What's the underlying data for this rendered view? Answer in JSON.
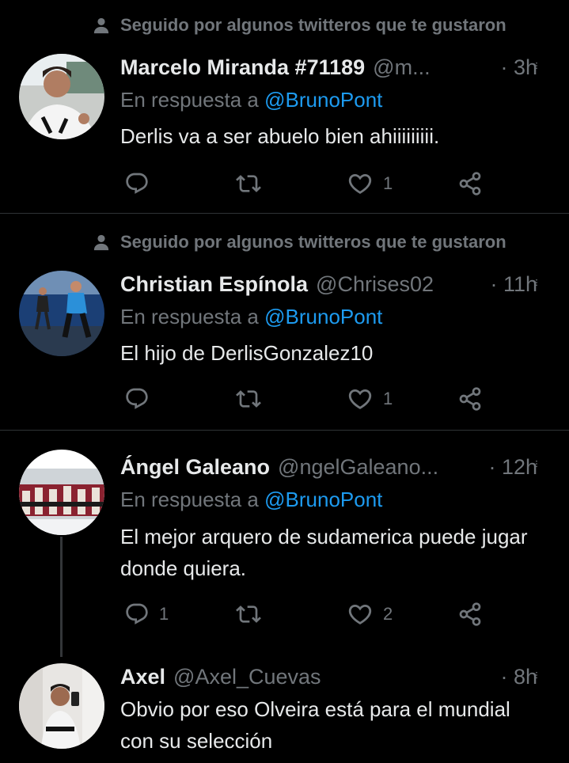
{
  "tweets": [
    {
      "social_context": "Seguido por algunos twitteros que te gustaron",
      "name": "Marcelo Miranda #71189",
      "handle": "@m...",
      "time": "· 3h",
      "reply_to_label": "En respuesta a",
      "reply_to_mention": "@BrunoPont",
      "text": "Derlis va a ser abuelo bien ahiiiiiiiii.",
      "reply_count": "",
      "like_count": "1"
    },
    {
      "social_context": "Seguido por algunos twitteros que te gustaron",
      "name": "Christian Espínola",
      "handle": "@Chrises02",
      "time": "· 11h",
      "reply_to_label": "En respuesta a",
      "reply_to_mention": "@BrunoPont",
      "text": "El hijo de DerlisGonzalez10",
      "reply_count": "",
      "like_count": "1"
    },
    {
      "name": "Ángel Galeano",
      "handle": "@ngelGaleano...",
      "time": "· 12h",
      "reply_to_label": "En respuesta a",
      "reply_to_mention": "@BrunoPont",
      "text": "El mejor arquero de sudamerica puede jugar donde quiera.",
      "reply_count": "1",
      "like_count": "2"
    },
    {
      "name": "Axel",
      "handle": "@Axel_Cuevas",
      "time": "· 8h",
      "text": "Obvio por eso Olveira está para el mundial con su selección"
    }
  ],
  "icons": {
    "social": "person-icon",
    "more": "more-vertical-icon",
    "reply": "reply-icon",
    "retweet": "retweet-icon",
    "like": "like-icon",
    "share": "share-icon"
  },
  "colors": {
    "background": "#000000",
    "text": "#e7e9ea",
    "muted": "#71767b",
    "link": "#1d9bf0",
    "divider": "#2f3336"
  }
}
